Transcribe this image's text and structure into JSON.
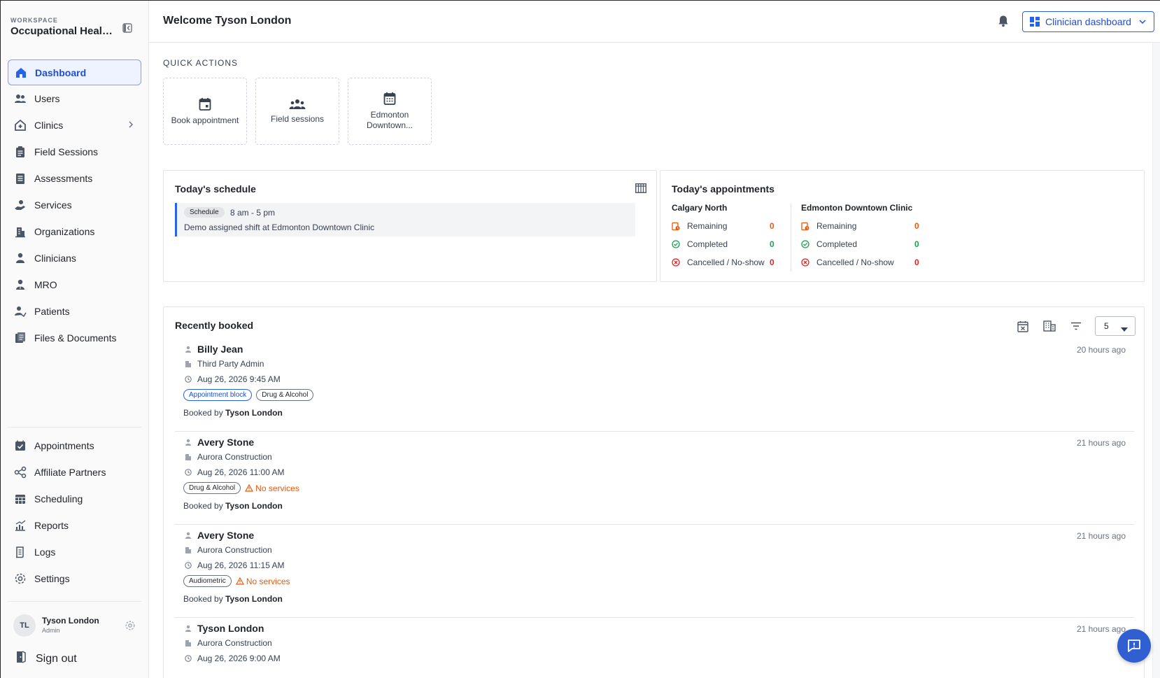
{
  "workspace": {
    "label": "WORKSPACE",
    "name": "Occupational Health Services"
  },
  "nav_top": [
    {
      "label": "Dashboard",
      "icon": "home-icon",
      "active": true
    },
    {
      "label": "Users",
      "icon": "users-icon"
    },
    {
      "label": "Clinics",
      "icon": "clinic-icon",
      "has_children": true
    },
    {
      "label": "Field Sessions",
      "icon": "clipboard-icon"
    },
    {
      "label": "Assessments",
      "icon": "assessment-icon"
    },
    {
      "label": "Services",
      "icon": "services-icon"
    },
    {
      "label": "Organizations",
      "icon": "organization-icon"
    },
    {
      "label": "Clinicians",
      "icon": "clinician-icon"
    },
    {
      "label": "MRO",
      "icon": "mro-icon"
    },
    {
      "label": "Patients",
      "icon": "patient-icon"
    },
    {
      "label": "Files & Documents",
      "icon": "files-icon"
    }
  ],
  "nav_bottom": [
    {
      "label": "Appointments",
      "icon": "appointments-icon"
    },
    {
      "label": "Affiliate Partners",
      "icon": "partners-icon"
    },
    {
      "label": "Scheduling",
      "icon": "scheduling-icon"
    },
    {
      "label": "Reports",
      "icon": "reports-icon"
    },
    {
      "label": "Logs",
      "icon": "logs-icon"
    },
    {
      "label": "Settings",
      "icon": "settings-icon"
    }
  ],
  "user": {
    "initials": "TL",
    "name": "Tyson London",
    "role": "Admin"
  },
  "signout_label": "Sign out",
  "header": {
    "welcome": "Welcome Tyson London",
    "dashboard_select": "Clinician dashboard"
  },
  "quick_actions": {
    "title": "QUICK ACTIONS",
    "items": [
      {
        "label": "Book appointment",
        "icon": "calendar-icon"
      },
      {
        "label": "Field sessions",
        "icon": "group-icon"
      },
      {
        "label": "Edmonton Downtown...",
        "icon": "calendar-grid-icon"
      }
    ]
  },
  "schedule": {
    "title": "Today's schedule",
    "badge": "Schedule",
    "time": "8 am - 5 pm",
    "description": "Demo assigned shift at Edmonton Downtown Clinic"
  },
  "appointments": {
    "title": "Today's appointments",
    "clinics": [
      {
        "name": "Calgary North",
        "remaining_label": "Remaining",
        "remaining": "0",
        "completed_label": "Completed",
        "completed": "0",
        "cancelled_label": "Cancelled / No-show",
        "cancelled": "0"
      },
      {
        "name": "Edmonton Downtown Clinic",
        "remaining_label": "Remaining",
        "remaining": "0",
        "completed_label": "Completed",
        "completed": "0",
        "cancelled_label": "Cancelled / No-show",
        "cancelled": "0"
      }
    ],
    "colors": {
      "remaining": "#ea580c",
      "completed": "#16a34a",
      "cancelled": "#dc2626"
    }
  },
  "recent": {
    "title": "Recently booked",
    "page_size": "5",
    "booked_by_prefix": "Booked by",
    "items": [
      {
        "name": "Billy Jean",
        "org": "Third Party Admin",
        "date": "Aug 26, 2026 9:45 AM",
        "tag1": "Appointment block",
        "tag2": "Drug & Alcohol",
        "booked_by": "Tyson London",
        "time_ago": "20 hours ago"
      },
      {
        "name": "Avery Stone",
        "org": "Aurora Construction",
        "date": "Aug 26, 2026 11:00 AM",
        "tag1": "Drug & Alcohol",
        "warning": "No services",
        "booked_by": "Tyson London",
        "time_ago": "21 hours ago"
      },
      {
        "name": "Avery Stone",
        "org": "Aurora Construction",
        "date": "Aug 26, 2026 11:15 AM",
        "tag1": "Audiometric",
        "warning": "No services",
        "booked_by": "Tyson London",
        "time_ago": "21 hours ago"
      },
      {
        "name": "Tyson London",
        "org": "Aurora Construction",
        "date": "Aug 26, 2026 9:00 AM",
        "time_ago": "21 hours ago"
      }
    ]
  },
  "accent_color": "#2563eb"
}
